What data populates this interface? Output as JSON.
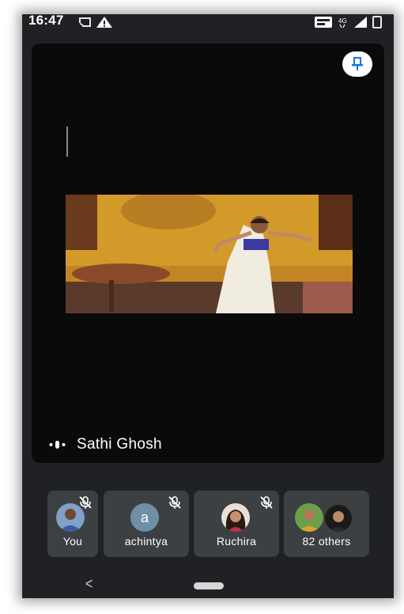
{
  "status_bar": {
    "time": "16:47",
    "network": "4G",
    "icons": [
      "cast-icon",
      "warning-icon",
      "volte-icon",
      "signal-icon",
      "battery-icon"
    ]
  },
  "main_tile": {
    "speaker_name": "Sathi Ghosh",
    "pin_icon": "pin-icon",
    "speaking_indicator": "audio-wave-icon"
  },
  "participants": [
    {
      "label": "You",
      "avatar": "photo",
      "muted": true
    },
    {
      "label": "achintya",
      "avatar_letter": "a",
      "muted": true
    },
    {
      "label": "Ruchira",
      "avatar": "photo",
      "muted": true
    },
    {
      "label": "82 others",
      "avatar": "photo-stack",
      "muted": false
    }
  ],
  "colors": {
    "background": "#202124",
    "tile": "#3c4043",
    "pin_accent": "#1a73e8"
  },
  "nav_bar": {
    "back_icon": "back-chevron-icon",
    "home_icon": "home-pill-icon"
  }
}
